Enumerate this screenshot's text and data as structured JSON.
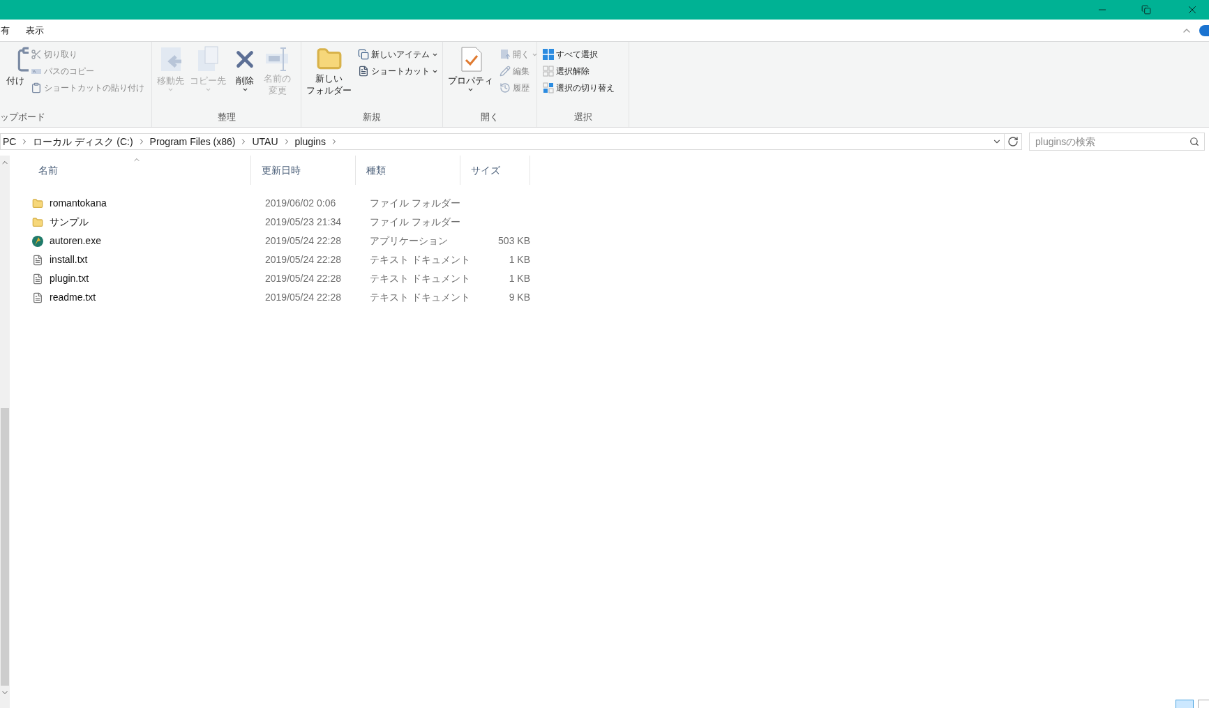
{
  "menu_tabs": [
    {
      "label": "有",
      "selected": false
    },
    {
      "label": "表示",
      "selected": false
    }
  ],
  "ribbon": {
    "groups": [
      {
        "label": "ップボード",
        "items": [
          {
            "kind": "large",
            "label": "付け",
            "disabled": false,
            "dropdown": false
          },
          {
            "kind": "small",
            "label": "切り取り",
            "disabled": true,
            "dropdown": false
          },
          {
            "kind": "small",
            "label": "パスのコピー",
            "disabled": true,
            "dropdown": false
          },
          {
            "kind": "small",
            "label": "ショートカットの貼り付け",
            "disabled": true,
            "dropdown": false
          }
        ]
      },
      {
        "label": "整理",
        "items": [
          {
            "kind": "large",
            "label": "移動先",
            "disabled": true,
            "dropdown": true
          },
          {
            "kind": "large",
            "label": "コピー先",
            "disabled": true,
            "dropdown": true
          },
          {
            "kind": "large",
            "label": "削除",
            "disabled": false,
            "dropdown": true
          },
          {
            "kind": "large",
            "label": [
              "名前の",
              "変更"
            ],
            "disabled": true,
            "dropdown": false
          }
        ]
      },
      {
        "label": "新規",
        "items": [
          {
            "kind": "large",
            "label": [
              "新しい",
              "フォルダー"
            ],
            "disabled": false,
            "dropdown": false
          },
          {
            "kind": "small",
            "label": "新しいアイテム",
            "disabled": false,
            "dropdown": true
          },
          {
            "kind": "small",
            "label": "ショートカット",
            "disabled": false,
            "dropdown": true
          }
        ]
      },
      {
        "label": "開く",
        "items": [
          {
            "kind": "large",
            "label": "プロパティ",
            "disabled": false,
            "dropdown": true
          },
          {
            "kind": "small",
            "label": "開く",
            "disabled": true,
            "dropdown": true
          },
          {
            "kind": "small",
            "label": "編集",
            "disabled": true,
            "dropdown": false
          },
          {
            "kind": "small",
            "label": "履歴",
            "disabled": true,
            "dropdown": false
          }
        ]
      },
      {
        "label": "選択",
        "items": [
          {
            "kind": "small",
            "label": "すべて選択",
            "disabled": false,
            "dropdown": false
          },
          {
            "kind": "small",
            "label": "選択解除",
            "disabled": false,
            "dropdown": false
          },
          {
            "kind": "small",
            "label": "選択の切り替え",
            "disabled": false,
            "dropdown": false
          }
        ]
      }
    ]
  },
  "address": {
    "segments": [
      "PC",
      "ローカル ディスク (C:)",
      "Program Files (x86)",
      "UTAU",
      "plugins"
    ]
  },
  "search": {
    "placeholder": "pluginsの検索"
  },
  "columns": [
    "名前",
    "更新日時",
    "種類",
    "サイズ"
  ],
  "rows": [
    {
      "kind": "folder",
      "name": "romantokana",
      "date": "2019/06/02 0:06",
      "type": "ファイル フォルダー",
      "size": ""
    },
    {
      "kind": "folder",
      "name": "サンプル",
      "date": "2019/05/23 21:34",
      "type": "ファイル フォルダー",
      "size": ""
    },
    {
      "kind": "exe",
      "name": "autoren.exe",
      "date": "2019/05/24 22:28",
      "type": "アプリケーション",
      "size": "503 KB"
    },
    {
      "kind": "text",
      "name": "install.txt",
      "date": "2019/05/24 22:28",
      "type": "テキスト ドキュメント",
      "size": "1 KB"
    },
    {
      "kind": "text",
      "name": "plugin.txt",
      "date": "2019/05/24 22:28",
      "type": "テキスト ドキュメント",
      "size": "1 KB"
    },
    {
      "kind": "text",
      "name": "readme.txt",
      "date": "2019/05/24 22:28",
      "type": "テキスト ドキュメント",
      "size": "9 KB"
    }
  ],
  "view_buttons": [
    {
      "selected": true
    },
    {
      "selected": false
    }
  ]
}
